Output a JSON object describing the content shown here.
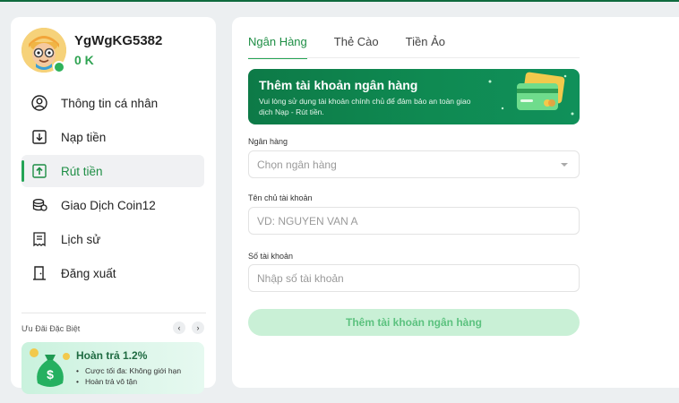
{
  "user": {
    "name": "YgWgKG5382",
    "balance": "0 K"
  },
  "menu": [
    {
      "label": "Thông tin cá nhân",
      "icon": "user-circle-icon",
      "active": false
    },
    {
      "label": "Nạp tiền",
      "icon": "deposit-arrow-icon",
      "active": false
    },
    {
      "label": "Rút tiền",
      "icon": "withdraw-arrow-icon",
      "active": true
    },
    {
      "label": "Giao Dịch Coin12",
      "icon": "coins-icon",
      "active": false
    },
    {
      "label": "Lịch sử",
      "icon": "receipt-icon",
      "active": false
    },
    {
      "label": "Đăng xuất",
      "icon": "door-exit-icon",
      "active": false
    }
  ],
  "promo": {
    "section_title": "Ưu Đãi Đặc Biệt",
    "heading": "Hoàn trả 1.2%",
    "items": [
      "Cược tối đa: Không giới hạn",
      "Hoàn trả vô tận"
    ]
  },
  "tabs": [
    {
      "label": "Ngân Hàng",
      "active": true
    },
    {
      "label": "Thẻ Cào",
      "active": false
    },
    {
      "label": "Tiền Ảo",
      "active": false
    }
  ],
  "banner": {
    "title": "Thêm tài khoản ngân hàng",
    "subtitle": "Vui lòng sử dụng tài khoản chính chủ để đảm bảo an toàn giao dịch Nạp - Rút tiền."
  },
  "form": {
    "bank_label": "Ngân hàng",
    "bank_placeholder": "Chọn ngân hàng",
    "holder_label": "Tên chủ tài khoản",
    "holder_placeholder": "VD: NGUYEN VAN A",
    "account_label": "Số tài khoản",
    "account_placeholder": "Nhập số tài khoản",
    "submit_label": "Thêm tài khoản ngân hàng"
  },
  "colors": {
    "accent": "#23a455",
    "banner": "#0f8a52",
    "submit_disabled_bg": "#c9f0d6"
  }
}
